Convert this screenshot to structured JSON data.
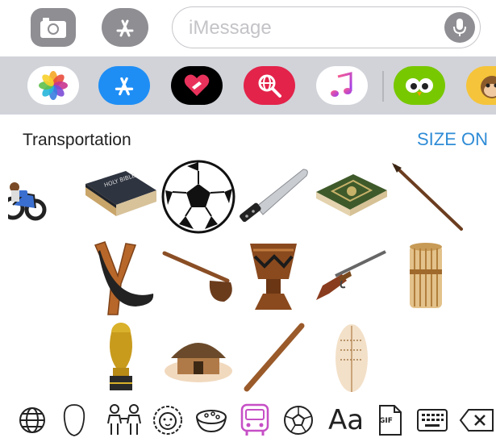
{
  "compose": {
    "placeholder": "iMessage"
  },
  "sticker_panel": {
    "category_title": "Transportation",
    "size_toggle_label": "SIZE ON"
  },
  "bottom_bar": {
    "text_style_label": "Aa",
    "gif_label": "GIF"
  },
  "colors": {
    "accent": "#2f8cd6",
    "drawer_bg": "#d1d3d9",
    "icon_gray": "#8e8e93",
    "selected_category": "#c64fc6"
  }
}
